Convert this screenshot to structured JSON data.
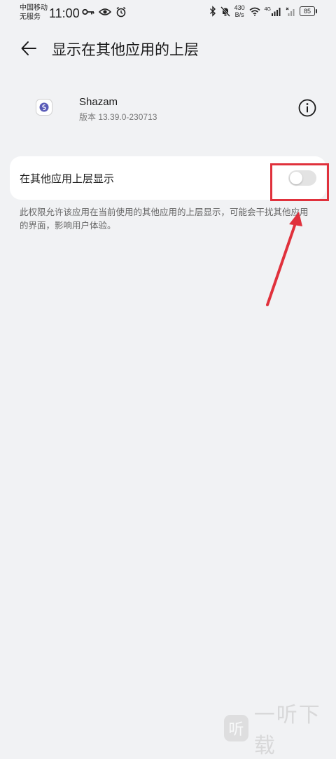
{
  "status_bar": {
    "carrier_line1": "中国移动",
    "carrier_line2": "无服务",
    "time": "11:00",
    "speed_value": "430",
    "speed_unit": "B/s",
    "network": "4G",
    "battery": "85"
  },
  "header": {
    "back_icon": "arrow-left-icon",
    "title": "显示在其他应用的上层"
  },
  "app": {
    "name": "Shazam",
    "version": "版本 13.39.0-230713",
    "info_icon": "info-icon"
  },
  "setting": {
    "label": "在其他应用上层显示",
    "enabled": false
  },
  "description": "此权限允许该应用在当前使用的其他应用的上层显示，可能会干扰其他应用的界面，影响用户体验。",
  "watermark": {
    "logo_text": "听",
    "text": "一听下载"
  },
  "colors": {
    "background": "#f1f2f4",
    "card": "#ffffff",
    "annotation_red": "#e0313c",
    "toggle_off": "#e3e3e3"
  }
}
